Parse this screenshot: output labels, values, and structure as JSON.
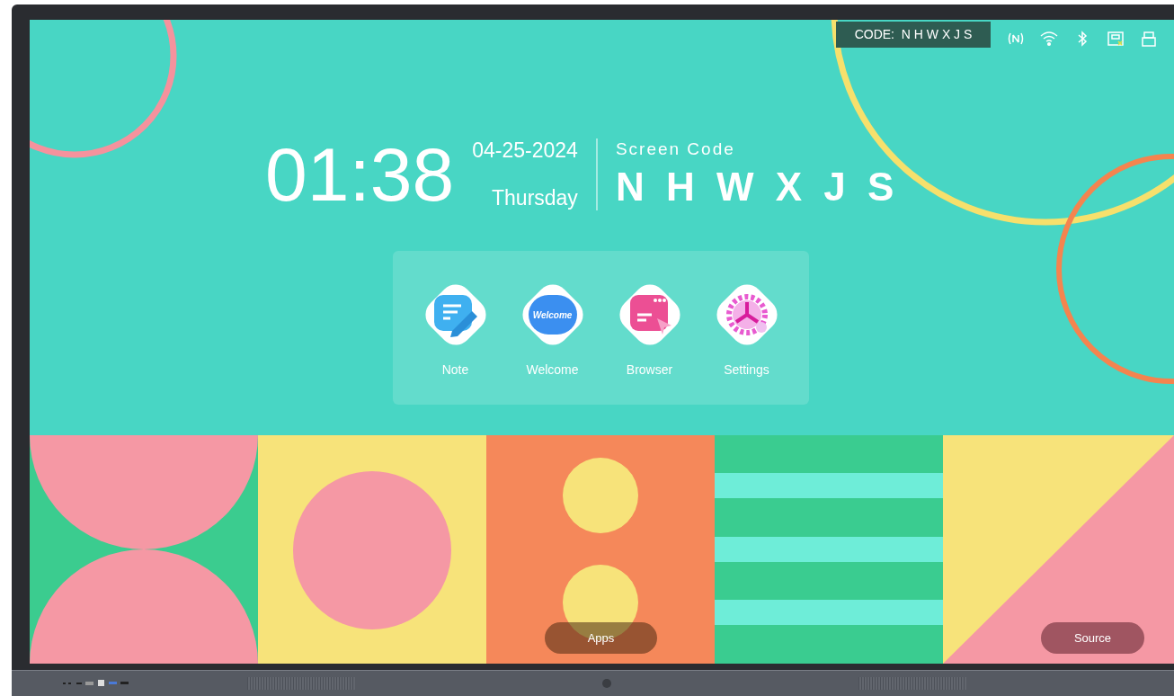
{
  "status_bar": {
    "code_badge": "CODE:  N H W X J S"
  },
  "clock": {
    "time": "01:38",
    "date": "04-25-2024",
    "weekday": "Thursday"
  },
  "screen_code": {
    "label": "Screen Code",
    "code": "N H W X J S"
  },
  "apps": [
    {
      "label": "Note",
      "kind": "note"
    },
    {
      "label": "Welcome",
      "kind": "welcome",
      "icon_text": "Welcome"
    },
    {
      "label": "Browser",
      "kind": "browser"
    },
    {
      "label": "Settings",
      "kind": "settings"
    }
  ],
  "bottom_bar": {
    "apps_button": "Apps",
    "source_button": "Source"
  }
}
